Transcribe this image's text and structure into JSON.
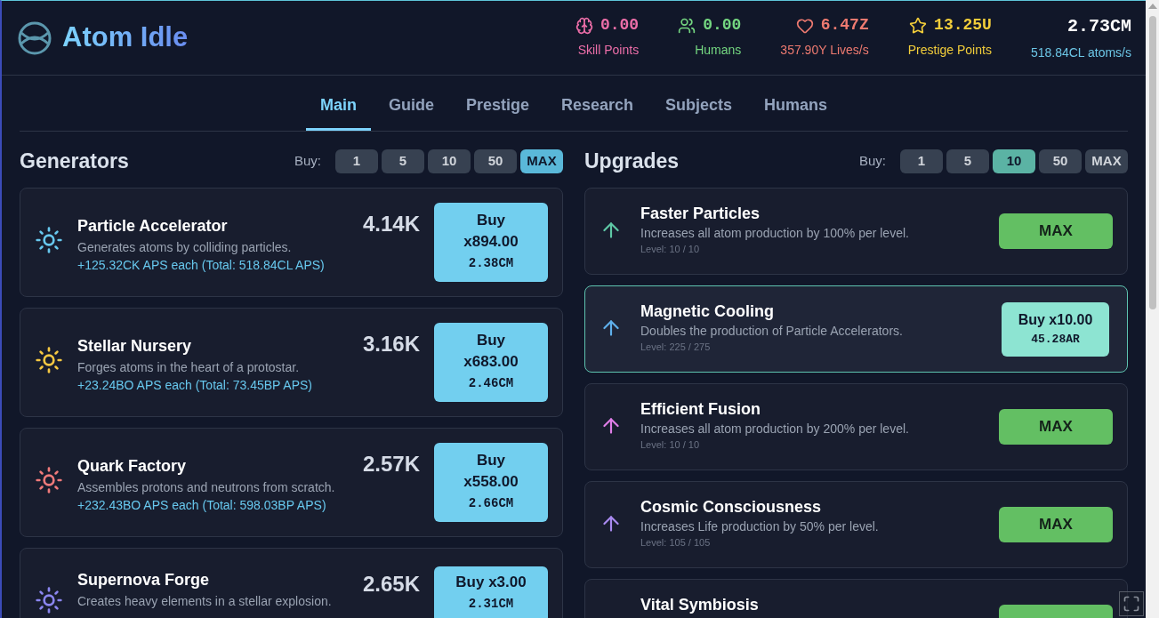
{
  "app": {
    "title": "Atom Idle"
  },
  "stats": [
    {
      "kind": "skill",
      "value": "0.00",
      "label": "Skill Points",
      "color": "#ec6ea8"
    },
    {
      "kind": "humans",
      "value": "0.00",
      "label": "Humans",
      "color": "#74d680"
    },
    {
      "kind": "lives",
      "value": "6.47Z",
      "label": "357.90Y Lives/s",
      "color": "#ee7a70"
    },
    {
      "kind": "prestige",
      "value": "13.25U",
      "label": "Prestige Points",
      "color": "#f2cd3a"
    },
    {
      "kind": "atoms",
      "value": "2.73CM",
      "label": "518.84CL atoms/s",
      "color": "#ffffff"
    }
  ],
  "tabs": [
    {
      "label": "Main",
      "selected": true
    },
    {
      "label": "Guide",
      "selected": false
    },
    {
      "label": "Prestige",
      "selected": false
    },
    {
      "label": "Research",
      "selected": false
    },
    {
      "label": "Subjects",
      "selected": false
    },
    {
      "label": "Humans",
      "selected": false
    }
  ],
  "generators": {
    "title": "Generators",
    "buy_label": "Buy:",
    "amounts": [
      {
        "label": "1",
        "selected": false
      },
      {
        "label": "5",
        "selected": false
      },
      {
        "label": "10",
        "selected": false
      },
      {
        "label": "50",
        "selected": false
      },
      {
        "label": "MAX",
        "selected": true
      }
    ],
    "items": [
      {
        "name": "Particle Accelerator",
        "description": "Generates atoms by colliding particles.",
        "production": "+125.32CK APS each (Total: 518.84CL APS)",
        "count": "4.14K",
        "buy": "Buy",
        "amount": "x894.00",
        "cost": "2.38CM",
        "color": "#67c8ee"
      },
      {
        "name": "Stellar Nursery",
        "description": "Forges atoms in the heart of a protostar.",
        "production": "+23.24BO APS each (Total: 73.45BP APS)",
        "count": "3.16K",
        "buy": "Buy",
        "amount": "x683.00",
        "cost": "2.46CM",
        "color": "#f5c842"
      },
      {
        "name": "Quark Factory",
        "description": "Assembles protons and neutrons from scratch.",
        "production": "+232.43BO APS each (Total: 598.03BP APS)",
        "count": "2.57K",
        "buy": "Buy",
        "amount": "x558.00",
        "cost": "2.66CM",
        "color": "#f07a7a"
      },
      {
        "name": "Supernova Forge",
        "description": "Creates heavy elements in a stellar explosion.",
        "count": "2.65K",
        "buy": "Buy x3.00",
        "cost": "2.31CM",
        "color": "#8b86f0"
      }
    ]
  },
  "upgrades": {
    "title": "Upgrades",
    "buy_label": "Buy:",
    "amounts": [
      {
        "label": "1",
        "selected": false
      },
      {
        "label": "5",
        "selected": false
      },
      {
        "label": "10",
        "selected": true
      },
      {
        "label": "50",
        "selected": false
      },
      {
        "label": "MAX",
        "selected": false
      }
    ],
    "items": [
      {
        "name": "Faster Particles",
        "description": "Increases all atom production by 100% per level.",
        "level": "Level: 10 / 10",
        "kind": "maxed",
        "button": "MAX",
        "color": "#5ec8a6"
      },
      {
        "name": "Magnetic Cooling",
        "description": "Doubles the production of Particle Accelerators.",
        "level": "Level: 225 / 275",
        "kind": "buyable",
        "button": "Buy x10.00",
        "cost": "45.28AR",
        "color": "#5fb0ec"
      },
      {
        "name": "Efficient Fusion",
        "description": "Increases all atom production by 200% per level.",
        "level": "Level: 10 / 10",
        "kind": "maxed",
        "button": "MAX",
        "color": "#e07ee8"
      },
      {
        "name": "Cosmic Consciousness",
        "description": "Increases Life production by 50% per level.",
        "level": "Level: 105 / 105",
        "kind": "maxed",
        "button": "MAX",
        "color": "#a98af0"
      },
      {
        "name": "Vital Symbiosis",
        "kind": "maxed"
      }
    ]
  }
}
